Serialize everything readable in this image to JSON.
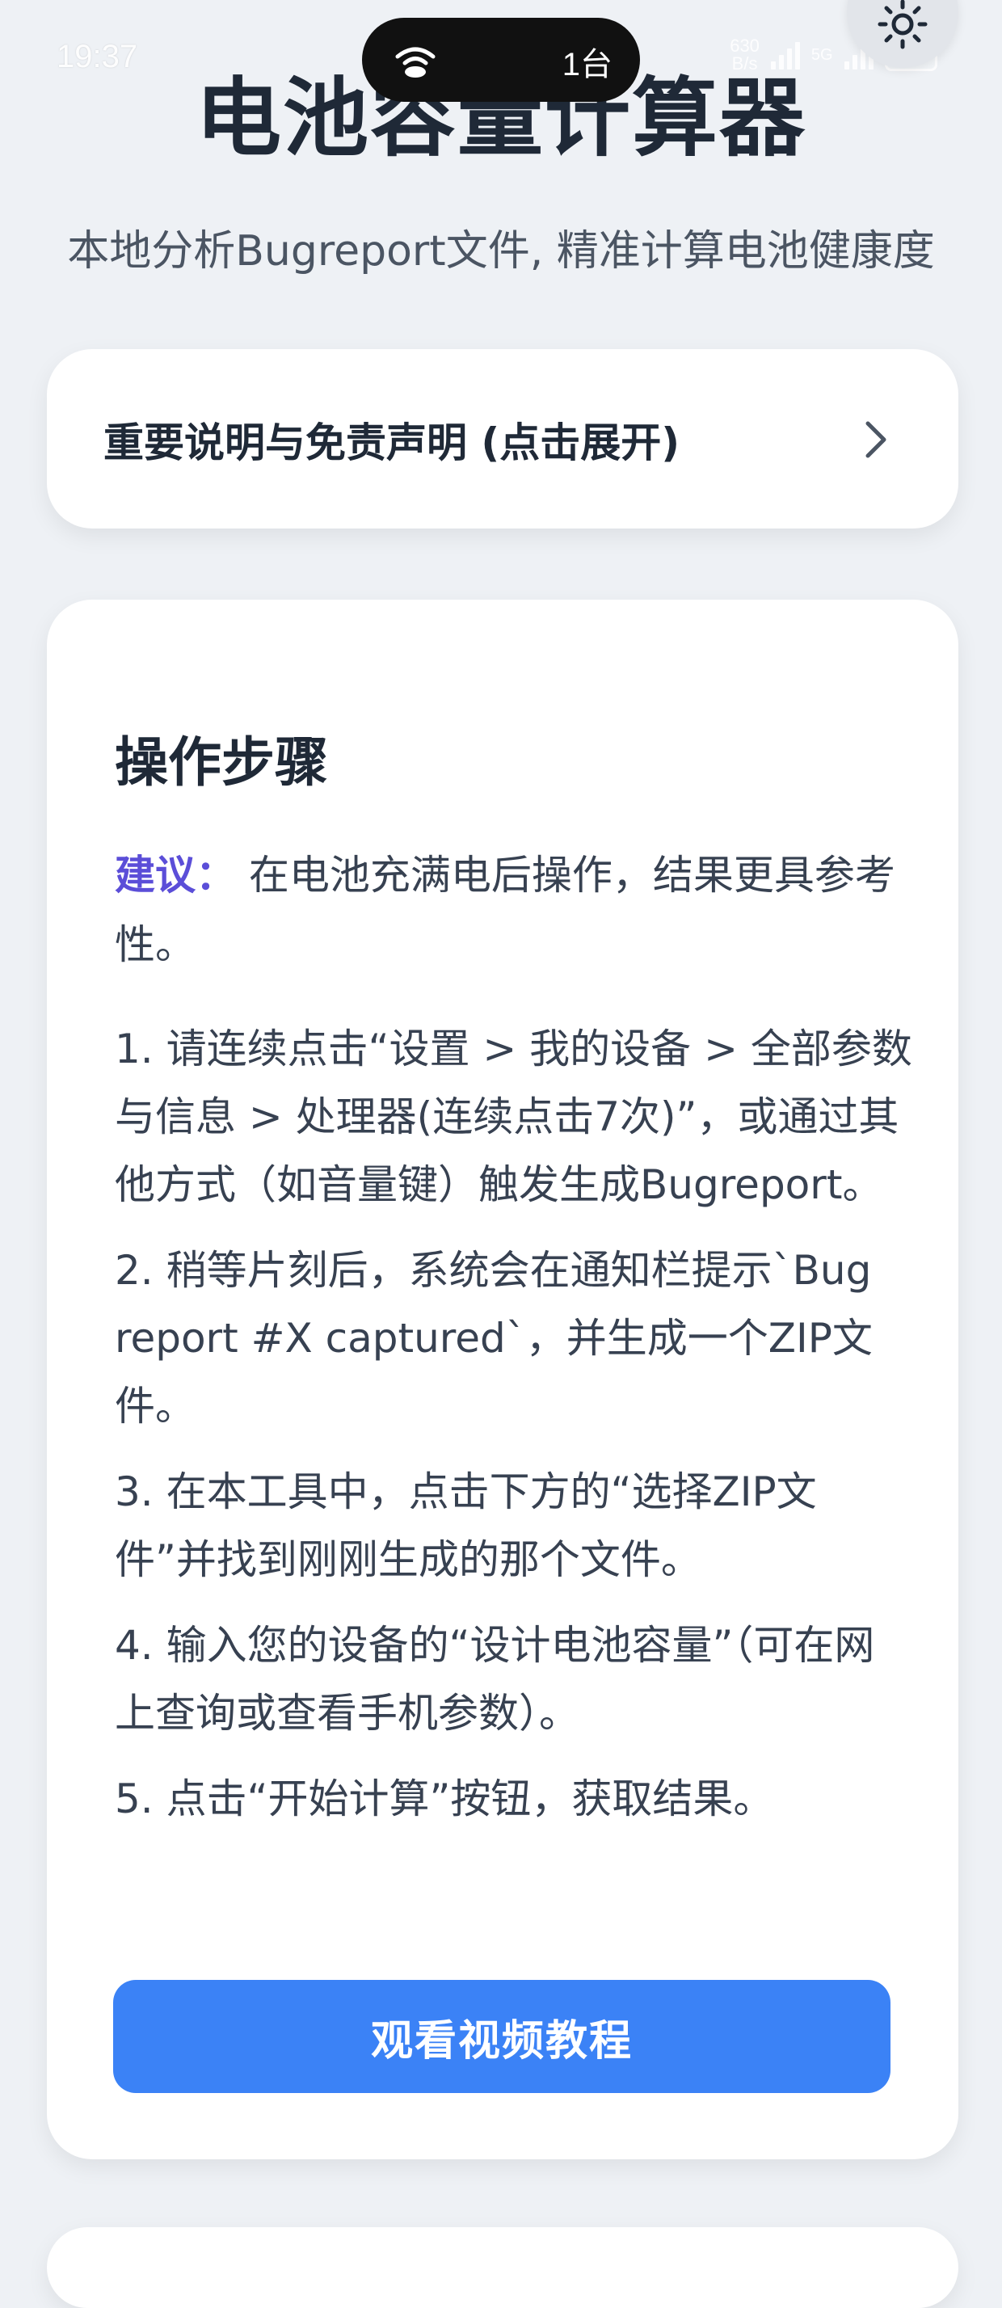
{
  "status_bar": {
    "time": "19:37",
    "island_count": "1台",
    "net_speed_value": "630",
    "net_speed_unit": "B/s",
    "net_label": "5G",
    "battery": "100"
  },
  "header": {
    "title": "电池容量计算器",
    "subtitle": "本地分析Bugreport文件, 精准计算电池健康度"
  },
  "disclaimer": {
    "label": "重要说明与免责声明 (点击展开)"
  },
  "steps": {
    "heading": "操作步骤",
    "tip_label": "建议：",
    "tip_text": " 在电池充满电后操作，结果更具参考性。",
    "items": [
      "1. 请连续点击“设置 > 我的设备 > 全部参数与信息 > 处理器(连续点击7次)”，或通过其他方式（如音量键）触发生成Bugreport。",
      "2. 稍等片刻后，系统会在通知栏提示`Bug report #X captured`，并生成一个ZIP文件。",
      "3. 在本工具中，点击下方的“选择ZIP文件”并找到刚刚生成的那个文件。",
      "4. 输入您的设备的“设计电池容量”（可在网上查询或查看手机参数）。",
      "5. 点击“开始计算”按钮，获取结果。"
    ],
    "video_button_label": "观看视频教程"
  },
  "colors": {
    "accent": "#3b82f6",
    "tip_label": "#5b4ed8",
    "background": "#eef1f5"
  }
}
